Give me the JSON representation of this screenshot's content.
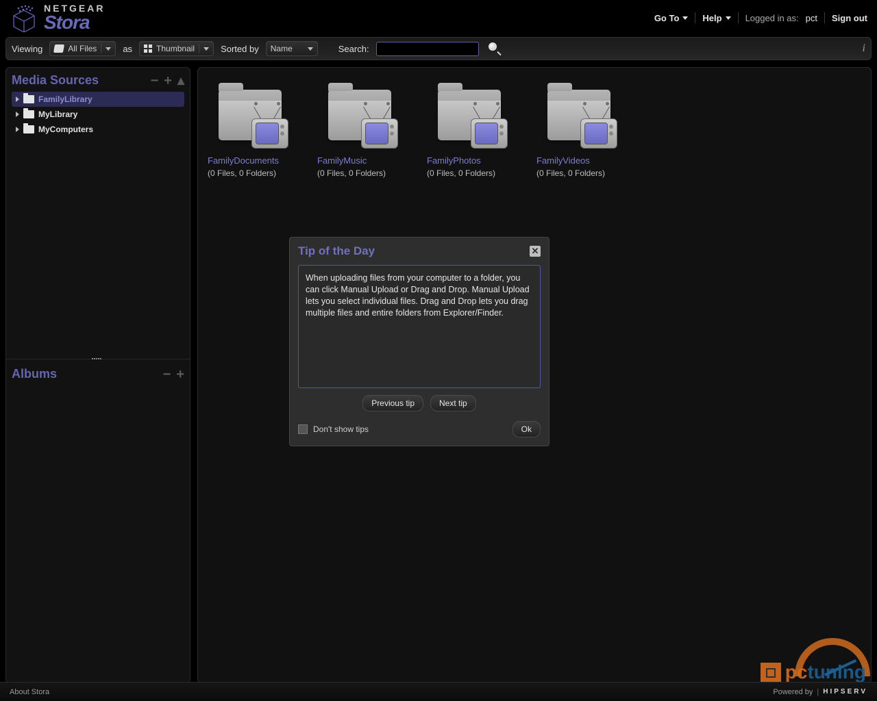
{
  "brand": {
    "top": "NETGEAR",
    "bottom": "Stora"
  },
  "header": {
    "goto": "Go To",
    "help": "Help",
    "logged_in_as": "Logged in as:",
    "user": "pct",
    "signout": "Sign out"
  },
  "toolbar": {
    "viewing": "Viewing",
    "filter_value": "All Files",
    "as": "as",
    "view_value": "Thumbnail",
    "sorted_by": "Sorted by",
    "sort_value": "Name",
    "search_label": "Search:"
  },
  "sidebar": {
    "media_title": "Media Sources",
    "tree": [
      {
        "label": "FamilyLibrary",
        "selected": true
      },
      {
        "label": "MyLibrary",
        "selected": false
      },
      {
        "label": "MyComputers",
        "selected": false
      }
    ],
    "albums_title": "Albums"
  },
  "folders": [
    {
      "name": "FamilyDocuments",
      "meta": "(0 Files, 0 Folders)"
    },
    {
      "name": "FamilyMusic",
      "meta": "(0 Files, 0 Folders)"
    },
    {
      "name": "FamilyPhotos",
      "meta": "(0 Files, 0 Folders)"
    },
    {
      "name": "FamilyVideos",
      "meta": "(0 Files, 0 Folders)"
    }
  ],
  "modal": {
    "title": "Tip of the Day",
    "body": "When uploading files from your computer to a folder, you can click Manual Upload or Drag and Drop. Manual Upload lets you select individual files. Drag and Drop lets you drag multiple files and entire folders from Explorer/Finder.",
    "prev": "Previous tip",
    "next": "Next tip",
    "dont_show": "Don't show tips",
    "ok": "Ok"
  },
  "footer": {
    "about": "About Stora",
    "powered": "Powered by",
    "vendor": "HIPSERV"
  },
  "watermark": {
    "a": "pc",
    "b": "tuning"
  }
}
